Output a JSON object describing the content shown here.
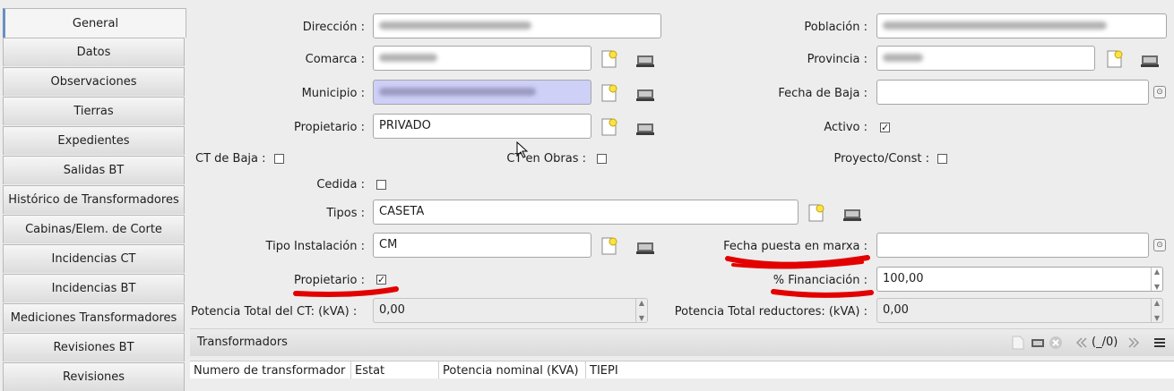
{
  "sidebar": {
    "tabs": [
      {
        "label": "General",
        "active": true
      },
      {
        "label": "Datos"
      },
      {
        "label": "Observaciones"
      },
      {
        "label": "Tierras"
      },
      {
        "label": "Expedientes"
      },
      {
        "label": "Salidas BT"
      },
      {
        "label": "Histórico de Transformadores"
      },
      {
        "label": "Cabinas/Elem. de Corte"
      },
      {
        "label": "Incidencias CT"
      },
      {
        "label": "Incidencias BT"
      },
      {
        "label": "Mediciones Transformadores"
      },
      {
        "label": "Revisiones BT"
      },
      {
        "label": "Revisiones"
      }
    ]
  },
  "form": {
    "direccion_label": "Dirección :",
    "poblacion_label": "Población :",
    "comarca_label": "Comarca :",
    "provincia_label": "Provincia :",
    "municipio_label": "Municipio :",
    "fecha_baja_label": "Fecha de Baja :",
    "propietario_label": "Propietario :",
    "propietario_value": "PRIVADO",
    "activo_label": "Activo :",
    "ct_baja_label": "CT de Baja :",
    "ct_obras_label": "CT en Obras :",
    "proyecto_label": "Proyecto/Const :",
    "cedida_label": "Cedida :",
    "tipos_label": "Tipos :",
    "tipos_value": "CASETA",
    "tipo_instalacion_label": "Tipo Instalación :",
    "tipo_instalacion_value": "CM",
    "fecha_puesta_label": "Fecha puesta en marxa :",
    "propietario2_label": "Propietario :",
    "financiacion_label": "% Financiación :",
    "financiacion_value": "100,00",
    "potencia_total_label": "Potencia Total del CT: (kVA) :",
    "potencia_total_value": "0,00",
    "potencia_reductores_label": "Potencia Total reductores: (kVA) :",
    "potencia_reductores_value": "0,00"
  },
  "checks": {
    "activo": true,
    "ct_baja": false,
    "ct_obras": false,
    "proyecto": false,
    "cedida": false,
    "propietario2": true
  },
  "transformadors": {
    "title": "Transformadors",
    "nav_count": "(_/0)",
    "columns": [
      "Numero de transformador",
      "Estat",
      "Potencia nominal (KVA)",
      "TIEPI"
    ]
  },
  "colors": {
    "annotation_red": "#e30000",
    "selected_field": "#cfd0f8"
  }
}
